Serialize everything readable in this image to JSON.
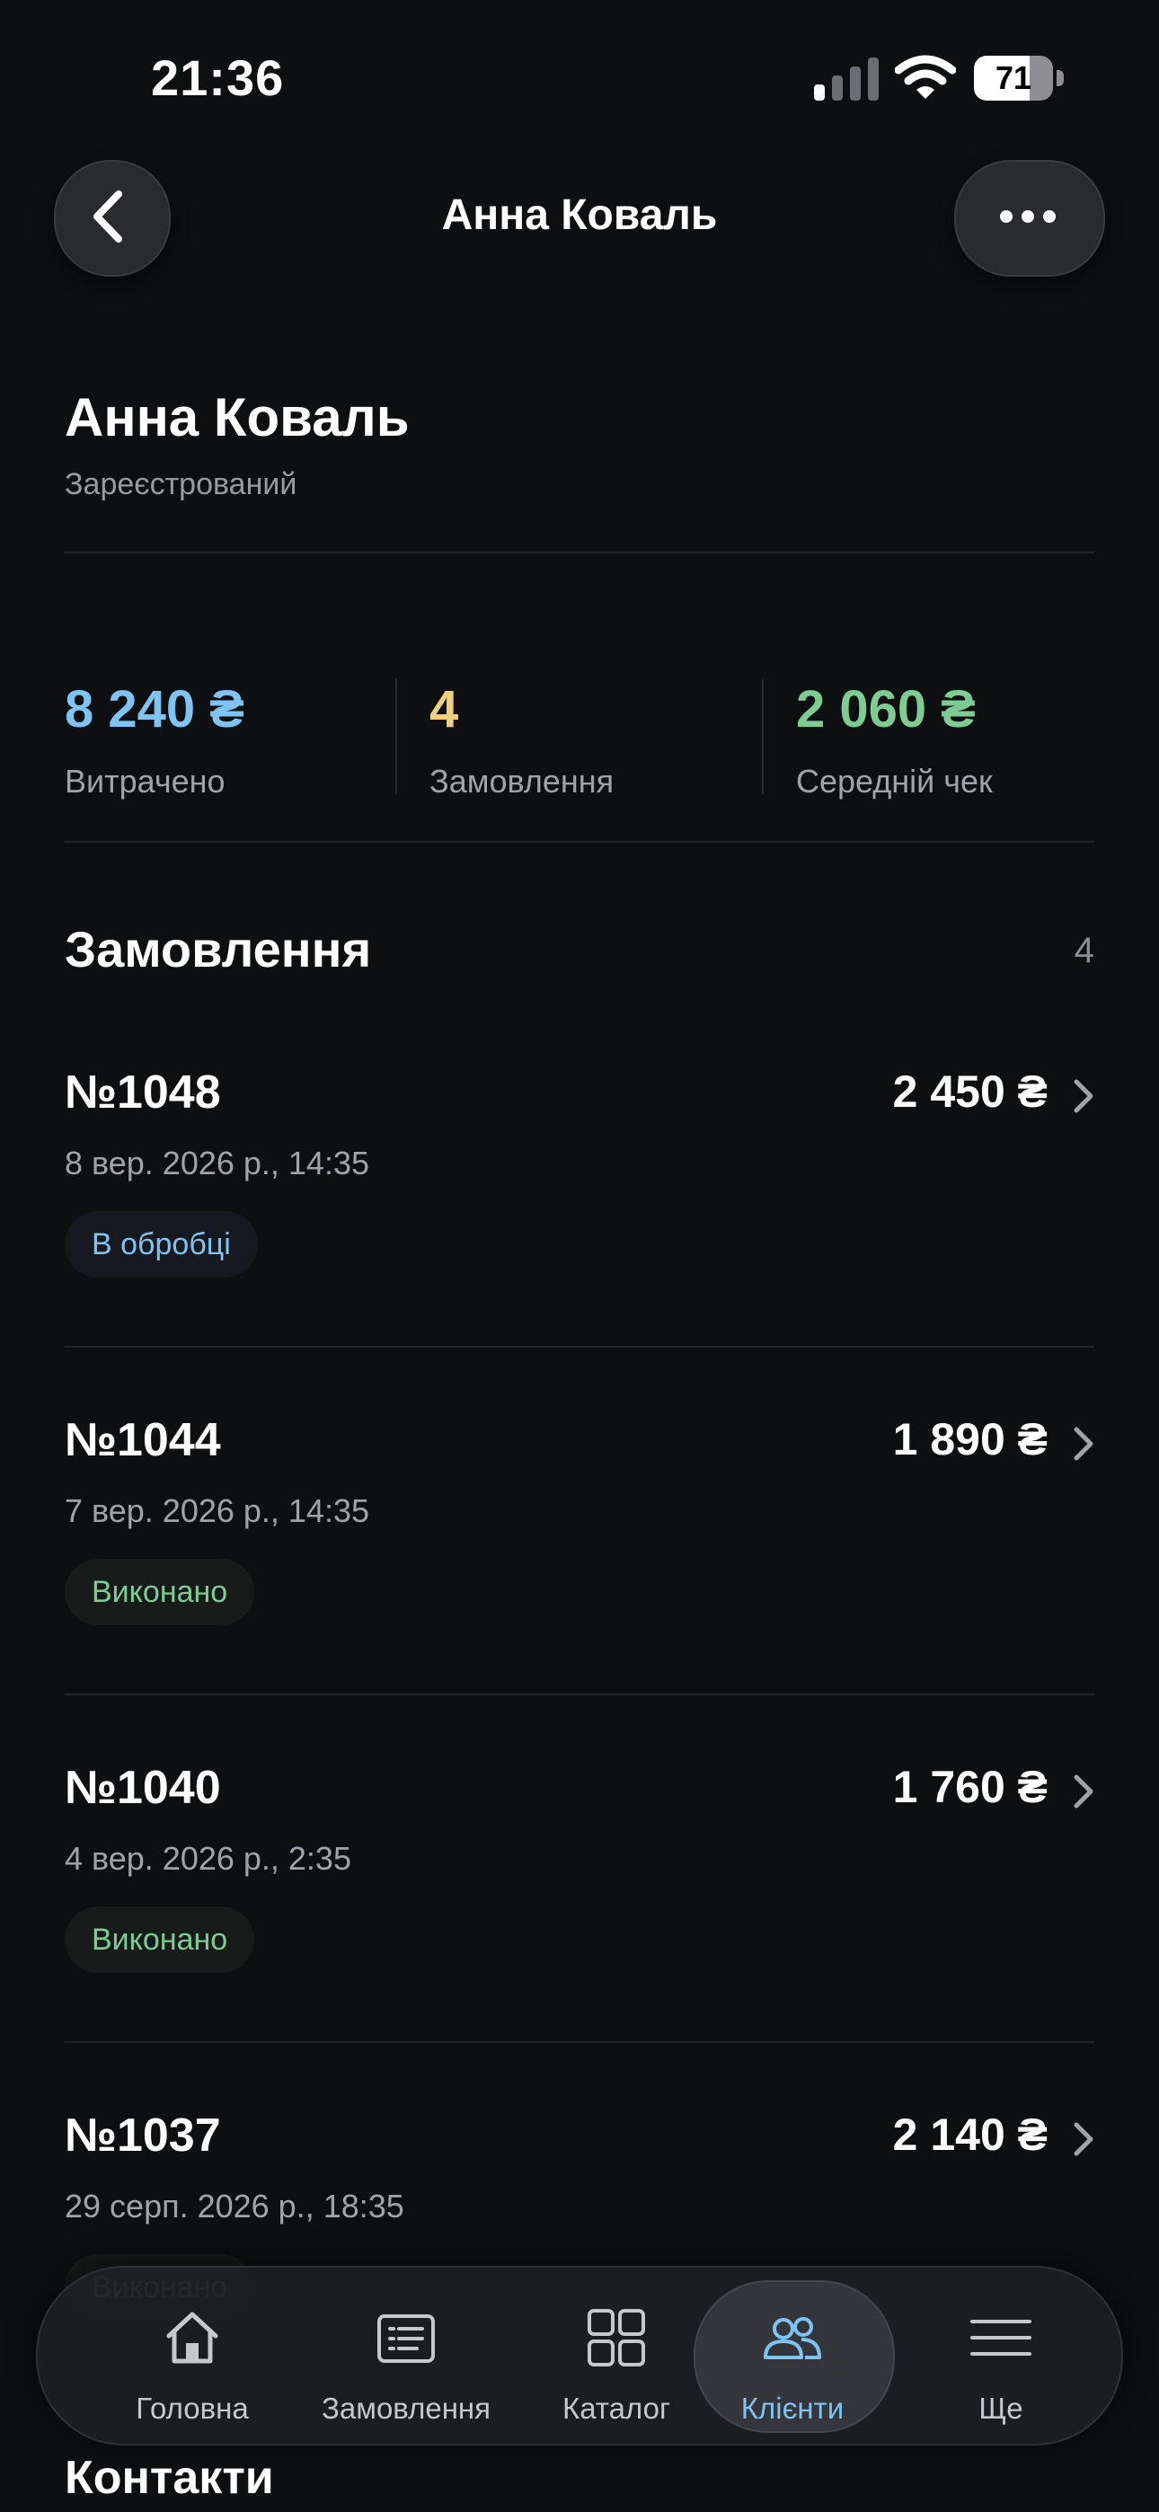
{
  "status_bar": {
    "time": "21:36",
    "battery": "71",
    "battery_level": 0.71
  },
  "nav": {
    "title": "Анна Коваль"
  },
  "customer": {
    "name": "Анна Коваль",
    "status": "Зареєстрований"
  },
  "stats": [
    {
      "value": "8 240 ₴",
      "label": "Витрачено",
      "color": "#7fc3f2"
    },
    {
      "value": "4",
      "label": "Замовлення",
      "color": "#f0cf7d"
    },
    {
      "value": "2 060 ₴",
      "label": "Середній чек",
      "color": "#7ccc94"
    }
  ],
  "orders_section": {
    "title": "Замовлення",
    "count": "4"
  },
  "orders": [
    {
      "number": "№1048",
      "amount": "2 450 ₴",
      "date": "8 вер. 2026 р., 14:35",
      "status": "В обробці",
      "status_kind": "processing"
    },
    {
      "number": "№1044",
      "amount": "1 890 ₴",
      "date": "7 вер. 2026 р., 14:35",
      "status": "Виконано",
      "status_kind": "done"
    },
    {
      "number": "№1040",
      "amount": "1 760 ₴",
      "date": "4 вер. 2026 р., 2:35",
      "status": "Виконано",
      "status_kind": "done"
    },
    {
      "number": "№1037",
      "amount": "2 140 ₴",
      "date": "29 серп. 2026 р., 18:35",
      "status": "Виконано",
      "status_kind": "done"
    }
  ],
  "contacts_section": {
    "title": "Контакти"
  },
  "tabbar": {
    "items": [
      {
        "label": "Головна",
        "icon": "home-icon"
      },
      {
        "label": "Замовлення",
        "icon": "orders-list-icon"
      },
      {
        "label": "Каталог",
        "icon": "catalog-grid-icon"
      },
      {
        "label": "Клієнти",
        "icon": "clients-icon",
        "active": true
      },
      {
        "label": "Ще",
        "icon": "menu-icon"
      }
    ]
  },
  "colors": {
    "background": "#0e0f11",
    "accent": "#7fc3f2",
    "success": "#7ccc94",
    "warning": "#f0cf7d"
  }
}
